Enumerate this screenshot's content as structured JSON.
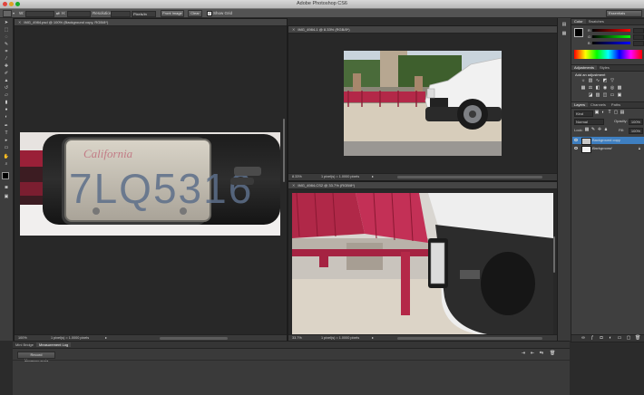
{
  "app": {
    "title": "Adobe Photoshop CS6",
    "workspace": "Essentials"
  },
  "options_bar": {
    "w_label": "W:",
    "h_label": "H:",
    "resolution_label": "Resolution:",
    "units": "Pixels/in",
    "front_image": "Front Image",
    "clear": "Clear",
    "show_grid": "Show Grid"
  },
  "documents": [
    {
      "tab": "IMG_4984.psd @ 100% (Background copy, RGB/8*)",
      "zoom": "100%",
      "info": "1 pixel(s) = 1.0000 pixels"
    },
    {
      "tab": "IMG_4984-1 @ 8.33% (RGB/8*)",
      "zoom": "8.33%",
      "info": "1 pixel(s) = 1.0000 pixels"
    },
    {
      "tab": "IMG_4984-CS2 @ 33.7% (RGB/8*)",
      "zoom": "33.7%",
      "info": "1 pixel(s) = 1.0000 pixels"
    }
  ],
  "plate_text": "7LQ5316",
  "bottom": {
    "tabs": [
      "Mini Bridge",
      "Measurement Log"
    ],
    "record_button": "Record Measurements"
  },
  "color_panel": {
    "tabs": [
      "Color",
      "Swatches"
    ],
    "channels": [
      "R",
      "G",
      "B"
    ]
  },
  "adjust_panel": {
    "tabs": [
      "Adjustments",
      "Styles"
    ],
    "heading": "Add an adjustment"
  },
  "layers_panel": {
    "tabs": [
      "Layers",
      "Channels",
      "Paths"
    ],
    "kind": "Kind",
    "blend": "Normal",
    "opacity_label": "Opacity:",
    "opacity": "100%",
    "lock_label": "Lock:",
    "fill_label": "Fill:",
    "fill": "100%",
    "layers": [
      {
        "name": "Background copy",
        "selected": true
      },
      {
        "name": "Background",
        "selected": false
      }
    ]
  },
  "colors": {
    "accent": "#3e7fc1",
    "panel": "#3f3f3f",
    "canvas": "#282828"
  }
}
